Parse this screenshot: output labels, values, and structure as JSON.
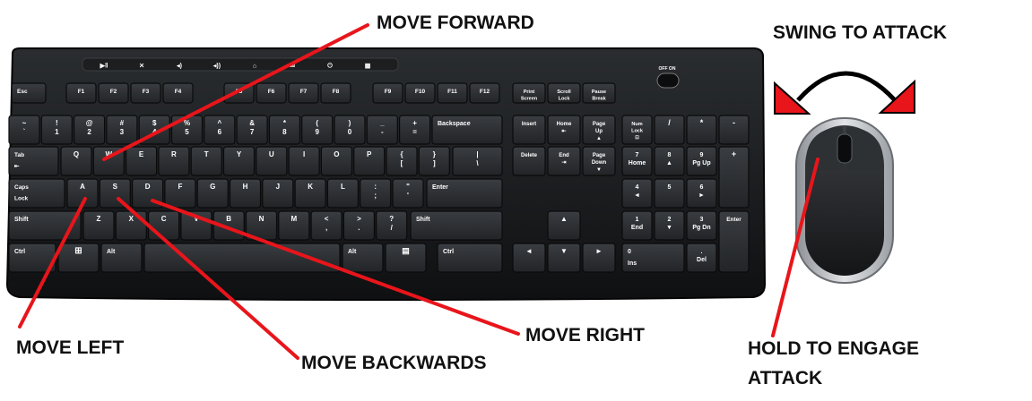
{
  "callouts": {
    "move_forward": "MOVE FORWARD",
    "swing_to_attack": "SWING TO ATTACK",
    "move_left": "MOVE LEFT",
    "move_backwards": "MOVE BACKWARDS",
    "move_right": "MOVE RIGHT",
    "hold_to_engage_line1": "HOLD TO ENGAGE",
    "hold_to_engage_line2": "ATTACK"
  },
  "colors": {
    "annotation_line": "#e8151b",
    "keyboard_body": "#17191b",
    "key_face": "#2b2e31",
    "key_label": "#ffffff",
    "mouse_shell": "#b9bcc0",
    "arrowhead": "#e8151b"
  },
  "keyboard": {
    "media_icons": [
      "play-pause-icon",
      "mute-icon",
      "volume-down-icon",
      "volume-up-icon",
      "home-icon",
      "mail-icon",
      "power-icon",
      "calculator-icon"
    ],
    "off_on_label": "OFF ON",
    "rows": {
      "function": [
        "Esc",
        "F1",
        "F2",
        "F3",
        "F4",
        "F5",
        "F6",
        "F7",
        "F8",
        "F9",
        "F10",
        "F11",
        "F12",
        "Print Screen",
        "Scroll Lock",
        "Pause Break"
      ],
      "number": [
        [
          "~",
          "`"
        ],
        [
          "!",
          "1"
        ],
        [
          "@",
          "2"
        ],
        [
          "#",
          "3"
        ],
        [
          "$",
          "4"
        ],
        [
          "%",
          "5"
        ],
        [
          "^",
          "6"
        ],
        [
          "&",
          "7"
        ],
        [
          "*",
          "8"
        ],
        [
          "(",
          "9"
        ],
        [
          ")",
          "0"
        ],
        [
          "_",
          "-"
        ],
        [
          "+",
          "="
        ],
        [
          "Backspace",
          ""
        ]
      ],
      "qwerty": [
        "Tab",
        "Q",
        "W",
        "E",
        "R",
        "T",
        "Y",
        "U",
        "I",
        "O",
        "P",
        "{ [",
        "} ]",
        "| \\"
      ],
      "home": [
        "Caps Lock",
        "A",
        "S",
        "D",
        "F",
        "G",
        "H",
        "J",
        "K",
        "L",
        ": ;",
        "\" '",
        "Enter"
      ],
      "shift": [
        "Shift",
        "Z",
        "X",
        "C",
        "V",
        "B",
        "N",
        "M",
        "< ,",
        "> .",
        "? /",
        "Shift"
      ],
      "bottom": [
        "Ctrl",
        "win-key-icon",
        "Alt",
        "",
        "Alt",
        "menu-key-icon",
        "Ctrl"
      ],
      "nav": [
        "Insert",
        "Home",
        "Page Up",
        "Delete",
        "End",
        "Page Down"
      ],
      "numpad_top": [
        "Num Lock",
        "/",
        "*",
        "-"
      ],
      "numpad": [
        [
          "7",
          "Home"
        ],
        [
          "8",
          "▲"
        ],
        [
          "9",
          "Pg Up"
        ],
        [
          "4",
          "◄"
        ],
        [
          "5",
          ""
        ],
        [
          "6",
          "►"
        ],
        [
          "1",
          "End"
        ],
        [
          "2",
          "▼"
        ],
        [
          "3",
          "Pg Dn"
        ],
        [
          "0",
          "Ins"
        ],
        [
          ".",
          "Del"
        ]
      ],
      "numpad_side": [
        "+",
        "Enter"
      ]
    }
  }
}
